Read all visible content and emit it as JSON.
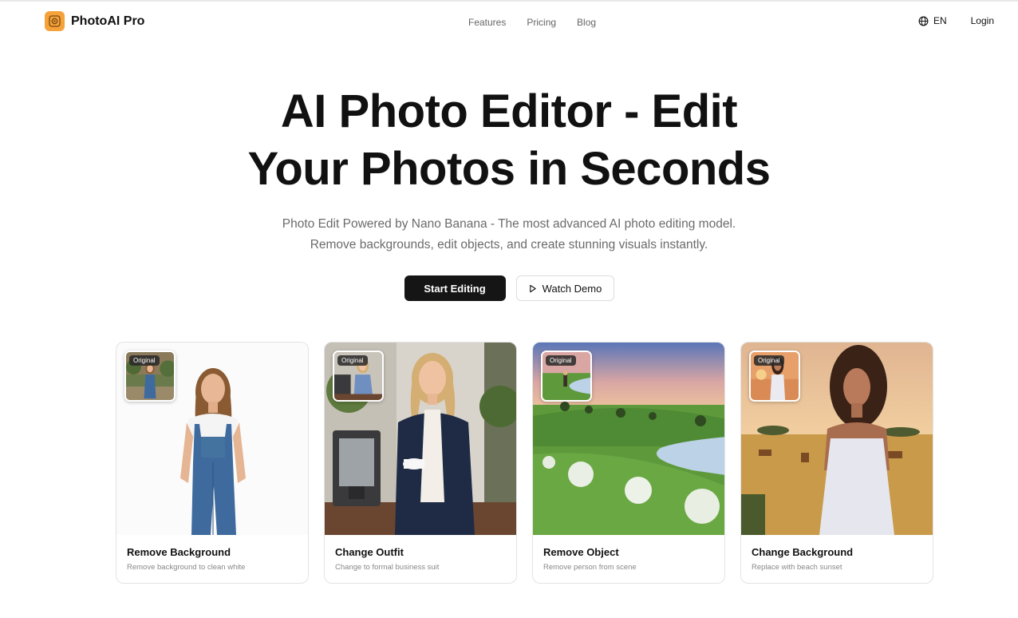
{
  "header": {
    "brand": "PhotoAI Pro",
    "nav": [
      "Features",
      "Pricing",
      "Blog"
    ],
    "language": "EN",
    "login": "Login"
  },
  "hero": {
    "title_line1": "AI Photo Editor - Edit",
    "title_line2": "Your Photos in Seconds",
    "subtitle_line1": "Photo Edit Powered by Nano Banana - The most advanced AI photo editing model.",
    "subtitle_line2": "Remove backgrounds, edit objects, and create stunning visuals instantly.",
    "primary_cta": "Start Editing",
    "secondary_cta": "Watch Demo"
  },
  "examples": [
    {
      "badge": "Original",
      "title": "Remove Background",
      "description": "Remove background to clean white"
    },
    {
      "badge": "Original",
      "title": "Change Outfit",
      "description": "Change to formal business suit"
    },
    {
      "badge": "Original",
      "title": "Remove Object",
      "description": "Remove person from scene"
    },
    {
      "badge": "Original",
      "title": "Change Background",
      "description": "Replace with beach sunset"
    }
  ],
  "colors": {
    "brand_logo": "#f5a23a",
    "primary_button": "#151515",
    "muted_text": "#6b6b6b"
  },
  "icons": [
    "camera-logo-icon",
    "globe-icon",
    "play-icon"
  ]
}
